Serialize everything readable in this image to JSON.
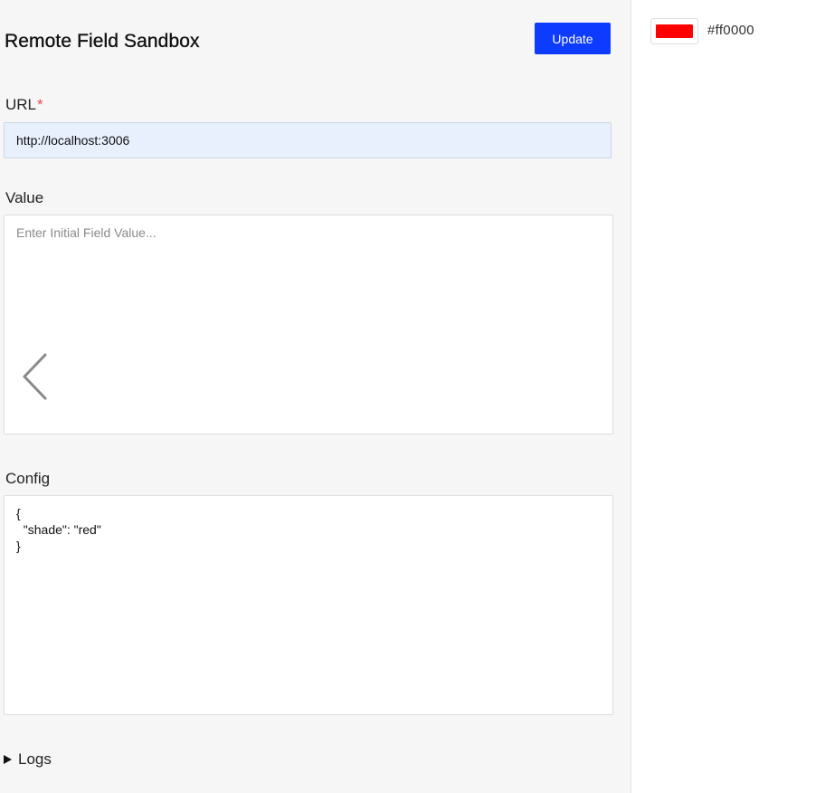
{
  "header": {
    "title": "Remote Field Sandbox",
    "update_label": "Update"
  },
  "url_field": {
    "label": "URL",
    "required_mark": "*",
    "value": "http://localhost:3006"
  },
  "value_field": {
    "label": "Value",
    "placeholder": "Enter Initial Field Value...",
    "value": ""
  },
  "config_field": {
    "label": "Config",
    "value": "{\n  \"shade\": \"red\"\n}"
  },
  "logs": {
    "label": "Logs"
  },
  "preview": {
    "color_hex": "#ff0000",
    "swatch_color": "#ff0000"
  },
  "colors": {
    "accent": "#0d3bff",
    "panel_bg": "#f6f6f6",
    "url_input_bg": "#e8f0fe",
    "required": "#e5484d"
  },
  "icons": {
    "value_widget": "chevron-left-icon",
    "logs_toggle": "triangle-right-icon"
  }
}
